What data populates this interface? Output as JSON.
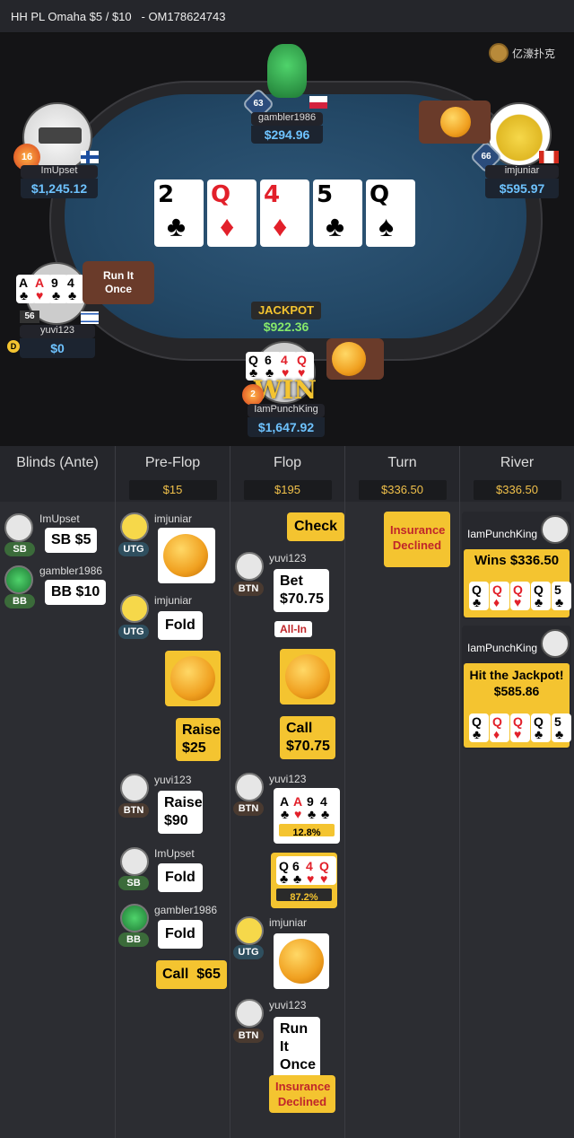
{
  "topbar": {
    "title": "HH PL Omaha $5 / $10",
    "hand_id": "OM178624743"
  },
  "brand": {
    "name": "亿濠扑克"
  },
  "colors": {
    "accent_yellow": "#f4c430",
    "stack_blue": "#6ec3ff",
    "jackpot_green": "#86e86a",
    "felt": "#234866"
  },
  "players": {
    "gambler": {
      "name": "gambler1986",
      "stack": "$294.96",
      "level": "63",
      "flag": "poland-flag"
    },
    "imupset": {
      "name": "ImUpset",
      "stack": "$1,245.12",
      "level": "16",
      "flag": "finland-flag"
    },
    "imjuniar": {
      "name": "imjuniar",
      "stack": "$595.97",
      "level": "66",
      "flag": "canada-flag"
    },
    "yuvi": {
      "name": "yuvi123",
      "stack": "$0",
      "level": "56",
      "flag": "israel-flag",
      "bubble": "Run It Once"
    },
    "punch": {
      "name": "IamPunchKing",
      "stack": "$1,647.92",
      "level": "2",
      "win_label": "WIN"
    }
  },
  "board": [
    {
      "rank": "2",
      "suit": "♣",
      "red": false
    },
    {
      "rank": "Q",
      "suit": "♦",
      "red": true
    },
    {
      "rank": "4",
      "suit": "♦",
      "red": true
    },
    {
      "rank": "5",
      "suit": "♣",
      "red": false
    },
    {
      "rank": "Q",
      "suit": "♠",
      "red": false
    }
  ],
  "yuvi_hand": [
    {
      "rank": "A",
      "suit": "♣",
      "red": false
    },
    {
      "rank": "A",
      "suit": "♥",
      "red": true
    },
    {
      "rank": "9",
      "suit": "♣",
      "red": false
    },
    {
      "rank": "4",
      "suit": "♣",
      "red": false
    }
  ],
  "punch_hand": [
    {
      "rank": "Q",
      "suit": "♣",
      "red": false
    },
    {
      "rank": "6",
      "suit": "♣",
      "red": false
    },
    {
      "rank": "4",
      "suit": "♥",
      "red": true
    },
    {
      "rank": "Q",
      "suit": "♥",
      "red": true
    }
  ],
  "jackpot": {
    "label": "JACKPOT",
    "value": "$922.36"
  },
  "dealer_label": "D",
  "columns": [
    {
      "title": "Blinds (Ante)",
      "pot": ""
    },
    {
      "title": "Pre-Flop",
      "pot": "$15"
    },
    {
      "title": "Flop",
      "pot": "$195"
    },
    {
      "title": "Turn",
      "pot": "$336.50"
    },
    {
      "title": "River",
      "pot": "$336.50"
    }
  ],
  "blinds": {
    "sb_name": "ImUpset",
    "sb_pos": "SB",
    "sb_action": "SB $5",
    "bb_name": "gambler1986",
    "bb_pos": "BB",
    "bb_action": "BB $10"
  },
  "preflop": {
    "a1_name": "imjuniar",
    "a1_pos": "UTG",
    "a2_name": "imjuniar",
    "a2_pos": "UTG",
    "a2_action": "Fold",
    "a3_action": "Raise $25",
    "a4_name": "yuvi123",
    "a4_pos": "BTN",
    "a4_action": "Raise $90",
    "a5_name": "ImUpset",
    "a5_pos": "SB",
    "a5_action": "Fold",
    "a6_name": "gambler1986",
    "a6_pos": "BB",
    "a6_action": "Fold",
    "a7_action": "Call  $65"
  },
  "flop": {
    "a1_action": "Check",
    "a2_name": "yuvi123",
    "a2_pos": "BTN",
    "a2_action": "Bet $70.75",
    "allin": "All-In",
    "a3_action": "Call $70.75",
    "a4_name": "yuvi123",
    "a4_pos": "BTN",
    "a4_equity": "12.8%",
    "a5_equity": "87.2%",
    "a6_name": "imjuniar",
    "a6_pos": "UTG",
    "a7_name": "yuvi123",
    "a7_pos": "BTN",
    "a7_action": "Run It Once",
    "a8_action": "Insurance Declined"
  },
  "turn": {
    "a1_action": "Insurance Declined"
  },
  "river": {
    "w1_name": "IamPunchKing",
    "w1_text": "Wins $336.50",
    "w2_name": "IamPunchKing",
    "w2_text": "Hit the Jackpot!",
    "w2_amount": "$585.86"
  },
  "river_cards": [
    {
      "rank": "Q",
      "suit": "♣",
      "red": false
    },
    {
      "rank": "Q",
      "suit": "♦",
      "red": true
    },
    {
      "rank": "Q",
      "suit": "♥",
      "red": true
    },
    {
      "rank": "Q",
      "suit": "♣",
      "red": false
    },
    {
      "rank": "5",
      "suit": "♣",
      "red": false
    }
  ]
}
